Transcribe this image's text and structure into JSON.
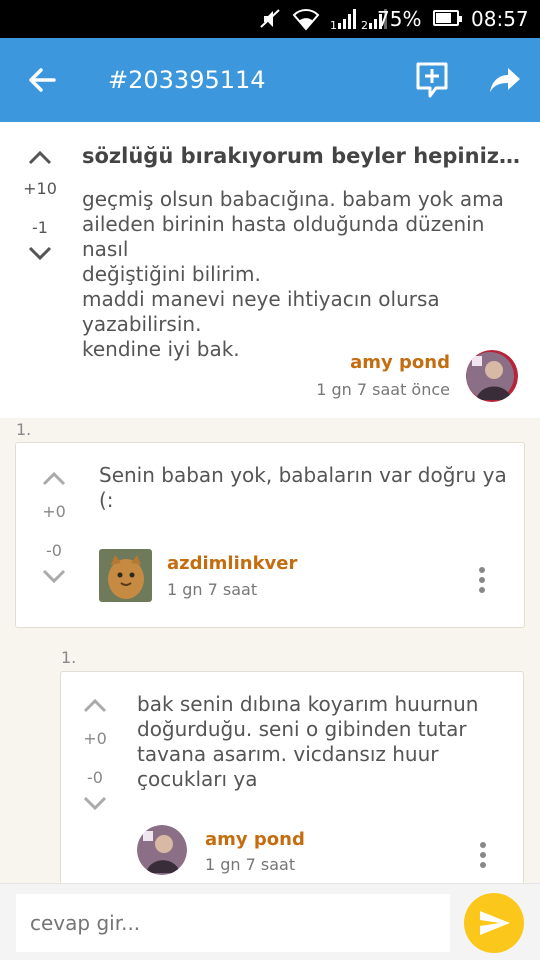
{
  "status_bar": {
    "battery": "75%",
    "time": "08:57"
  },
  "app_bar": {
    "title": "#203395114"
  },
  "topic": {
    "title": "sözlüğü bırakıyorum beyler hepiniz sağ…",
    "upvotes": "+10",
    "downvotes": "-1",
    "lines": [
      "geçmiş olsun babacığına. babam yok ama",
      "aileden birinin hasta olduğunda düzenin nasıl",
      "değiştiğini bilirim.",
      "maddi manevi neye ihtiyacın olursa",
      "yazabilirsin.",
      "kendine iyi bak."
    ],
    "author": "amy pond",
    "time": "1 gn 7 saat  önce"
  },
  "reply1": {
    "index": "1.",
    "upvotes": "+0",
    "downvotes": "-0",
    "text": "Senin baban yok, babaların var doğru ya (:",
    "author": "azdimlinkver",
    "time": "1 gn 7 saat"
  },
  "reply2": {
    "index": "1.",
    "upvotes": "+0",
    "downvotes": "-0",
    "lines": [
      "bak senin dıbına koyarım huurnun",
      "doğurduğu. seni o gibinden tutar",
      "tavana asarım. vicdansız huur",
      "çocukları ya"
    ],
    "author": "amy pond",
    "time": "1 gn 7 saat"
  },
  "composer": {
    "placeholder": "cevap gir..."
  },
  "colors": {
    "app_bar": "#3d97dd",
    "author": "#c46d10",
    "send_button": "#fac71a"
  },
  "icons": [
    "mute-icon",
    "wifi-icon",
    "signal-icon",
    "battery-icon",
    "back-arrow-icon",
    "add-entry-icon",
    "share-icon",
    "upvote-icon",
    "downvote-icon",
    "more-icon",
    "send-icon"
  ]
}
